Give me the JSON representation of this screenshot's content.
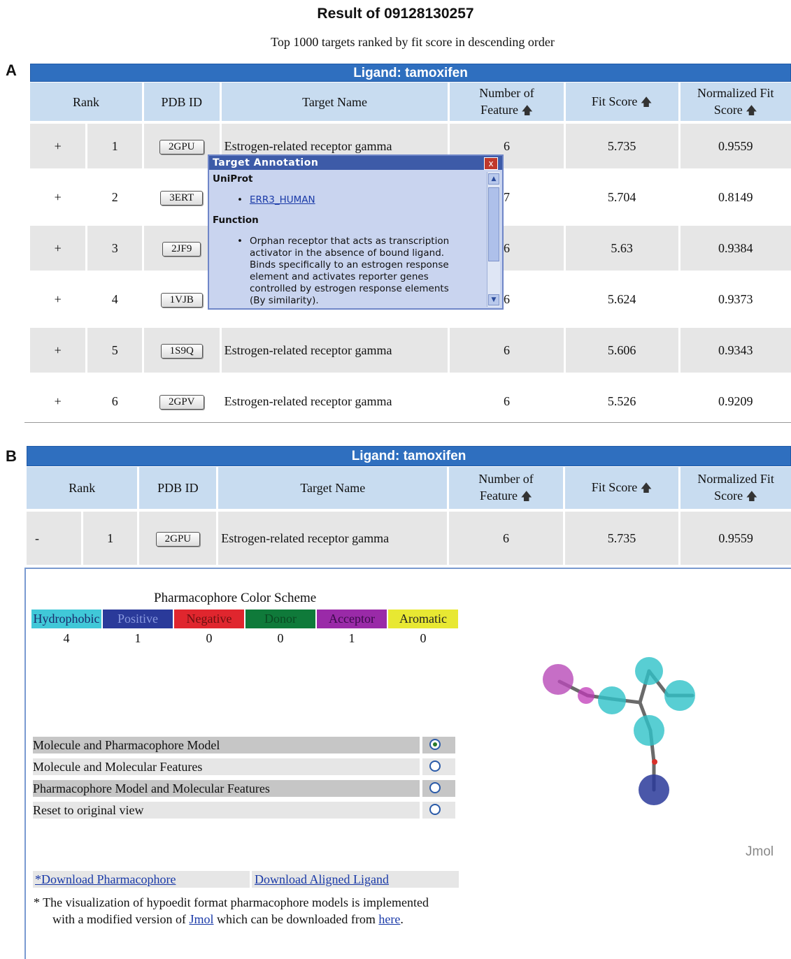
{
  "title": "Result of 09128130257",
  "subtitle": "Top 1000 targets ranked by fit score in descending order",
  "panel_a": {
    "letter": "A",
    "ligand_bar": "Ligand: tamoxifen",
    "headers": {
      "rank": "Rank",
      "pdb_id": "PDB ID",
      "target_name": "Target Name",
      "num_feature_1": "Number of",
      "num_feature_2": "Feature",
      "fit_score": "Fit Score",
      "norm_fit_1": "Normalized Fit",
      "norm_fit_2": "Score"
    },
    "rows": [
      {
        "toggle": "+",
        "rank": "1",
        "pdb": "2GPU",
        "name": "Estrogen-related receptor gamma",
        "features": "6",
        "fit": "5.735",
        "norm": "0.9559"
      },
      {
        "toggle": "+",
        "rank": "2",
        "pdb": "3ERT",
        "name": "",
        "features": "7",
        "fit": "5.704",
        "norm": "0.8149"
      },
      {
        "toggle": "+",
        "rank": "3",
        "pdb": "2JF9",
        "name": "",
        "features": "6",
        "fit": "5.63",
        "norm": "0.9384"
      },
      {
        "toggle": "+",
        "rank": "4",
        "pdb": "1VJB",
        "name": "",
        "features": "6",
        "fit": "5.624",
        "norm": "0.9373"
      },
      {
        "toggle": "+",
        "rank": "5",
        "pdb": "1S9Q",
        "name": "Estrogen-related receptor gamma",
        "features": "6",
        "fit": "5.606",
        "norm": "0.9343"
      },
      {
        "toggle": "+",
        "rank": "6",
        "pdb": "2GPV",
        "name": "Estrogen-related receptor gamma",
        "features": "6",
        "fit": "5.526",
        "norm": "0.9209"
      }
    ]
  },
  "popup": {
    "title": "Target Annotation",
    "close": "x",
    "uniprot_label": "UniProt",
    "uniprot_link": "ERR3_HUMAN",
    "function_label": "Function",
    "function_lines": [
      "Orphan receptor that acts as transcription",
      "activator in the absence of bound ligand.",
      "Binds specifically to an estrogen response",
      "element and activates reporter genes",
      "controlled by estrogen response elements",
      "(By similarity)."
    ]
  },
  "panel_b": {
    "letter": "B",
    "ligand_bar": "Ligand: tamoxifen",
    "row": {
      "toggle": "-",
      "rank": "1",
      "pdb": "2GPU",
      "name": "Estrogen-related receptor gamma",
      "features": "6",
      "fit": "5.735",
      "norm": "0.9559"
    },
    "color_scheme_title": "Pharmacophore Color Scheme",
    "color_scheme": [
      {
        "label": "Hydrophobic",
        "count": "4",
        "color": "#40c8d8",
        "text_color": "#1a2a6a"
      },
      {
        "label": "Positive",
        "count": "1",
        "color": "#2a3a9a",
        "text_color": "#8a9ae0"
      },
      {
        "label": "Negative",
        "count": "0",
        "color": "#e0262e",
        "text_color": "#6a1010"
      },
      {
        "label": "Donor",
        "count": "0",
        "color": "#0f7a3a",
        "text_color": "#0a4a22"
      },
      {
        "label": "Acceptor",
        "count": "1",
        "color": "#9a2aa8",
        "text_color": "#3a0a4a"
      },
      {
        "label": "Aromatic",
        "count": "0",
        "color": "#e8e832",
        "text_color": "#222222"
      }
    ],
    "view_options": [
      {
        "label": "Molecule and Pharmacophore Model",
        "selected": true
      },
      {
        "label": "Molecule and Molecular Features",
        "selected": false
      },
      {
        "label": "Pharmacophore Model and Molecular Features",
        "selected": false
      },
      {
        "label": "Reset to original view",
        "selected": false
      }
    ],
    "download_pharmacophore": "*Download Pharmacophore",
    "download_ligand": "Download Aligned Ligand",
    "note_prefix": "* The visualization of hypoedit format pharmacophore models is implemented",
    "note_line2_a": "with a modified version of ",
    "note_link1": "Jmol",
    "note_line2_b": " which can be downloaded from ",
    "note_link2": "here",
    "note_line2_c": ".",
    "jmol_label": "Jmol"
  }
}
